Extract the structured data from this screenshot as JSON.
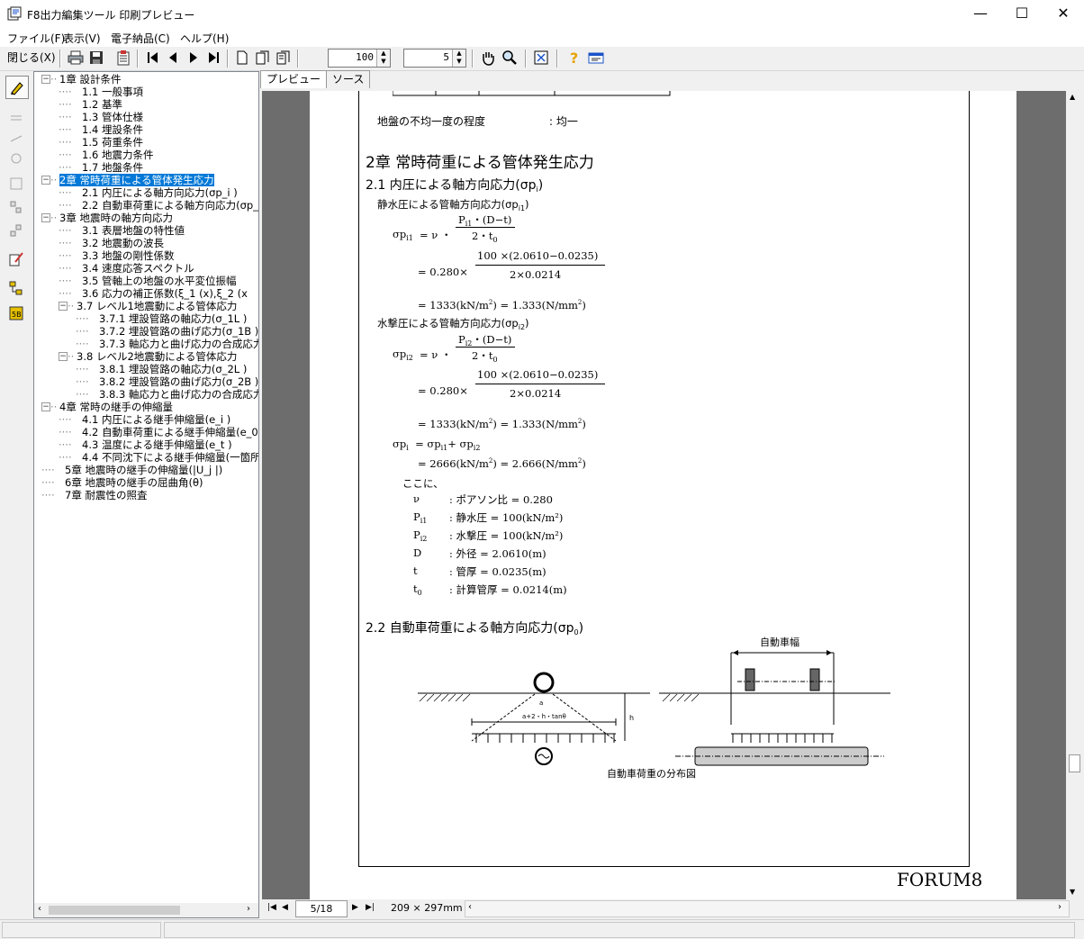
{
  "window": {
    "title": "F8出力編集ツール 印刷プレビュー",
    "minimize": "—",
    "maximize": "☐",
    "close": "✕"
  },
  "menu": [
    "ファイル(F)",
    "表示(V)",
    "電子納品(C)",
    "ヘルプ(H)"
  ],
  "toolbar": {
    "close_label": "閉じる(X)",
    "zoom_value": "100",
    "page_count_value": "5"
  },
  "tabs": [
    "プレビュー",
    "ソース"
  ],
  "tree": [
    {
      "label": "1章 設計条件",
      "level": 0,
      "box": "−"
    },
    {
      "label": "1.1 一般事項",
      "level": 1
    },
    {
      "label": "1.2 基準",
      "level": 1
    },
    {
      "label": "1.3 管体仕様",
      "level": 1
    },
    {
      "label": "1.4 埋設条件",
      "level": 1
    },
    {
      "label": "1.5 荷重条件",
      "level": 1
    },
    {
      "label": "1.6 地震力条件",
      "level": 1
    },
    {
      "label": "1.7 地盤条件",
      "level": 1
    },
    {
      "label": "2章 常時荷重による管体発生応力",
      "level": 0,
      "box": "−",
      "selected": true
    },
    {
      "label": "2.1 内圧による軸方向応力(σp_i )",
      "level": 1
    },
    {
      "label": "2.2 自動車荷重による軸方向応力(σp_",
      "level": 1
    },
    {
      "label": "3章 地震時の軸方向応力",
      "level": 0,
      "box": "−"
    },
    {
      "label": "3.1 表層地盤の特性値",
      "level": 1
    },
    {
      "label": "3.2 地震動の波長",
      "level": 1
    },
    {
      "label": "3.3 地盤の剛性係数",
      "level": 1
    },
    {
      "label": "3.4 速度応答スペクトル",
      "level": 1
    },
    {
      "label": "3.5 管軸上の地盤の水平変位振幅",
      "level": 1
    },
    {
      "label": "3.6 応力の補正係数(ξ_1 (x),ξ_2 (x",
      "level": 1
    },
    {
      "label": "3.7 レベル1地震動による管体応力",
      "level": 1,
      "box": "−"
    },
    {
      "label": "3.7.1 埋設管路の軸応力(σ_1L )",
      "level": 2
    },
    {
      "label": "3.7.2 埋設管路の曲げ応力(σ_1B )",
      "level": 2
    },
    {
      "label": "3.7.3 軸応力と曲げ応力の合成応力",
      "level": 2
    },
    {
      "label": "3.8 レベル2地震動による管体応力",
      "level": 1,
      "box": "−"
    },
    {
      "label": "3.8.1 埋設管路の軸応力(σ_2L )",
      "level": 2
    },
    {
      "label": "3.8.2 埋設管路の曲げ応力(σ_2B )",
      "level": 2
    },
    {
      "label": "3.8.3 軸応力と曲げ応力の合成応力",
      "level": 2
    },
    {
      "label": "4章 常時の継手の伸縮量",
      "level": 0,
      "box": "−"
    },
    {
      "label": "4.1 内圧による継手伸縮量(e_i )",
      "level": 1
    },
    {
      "label": "4.2 自動車荷重による継手伸縮量(e_0",
      "level": 1
    },
    {
      "label": "4.3 温度による継手伸縮量(e_t )",
      "level": 1
    },
    {
      "label": "4.4 不同沈下による継手伸縮量(一箇所",
      "level": 1
    },
    {
      "label": "5章 地震時の継手の伸縮量(|U_j |)",
      "level": 0
    },
    {
      "label": "6章 地震時の継手の屈曲角(θ)",
      "level": 0
    },
    {
      "label": "7章 耐震性の照査",
      "level": 0
    }
  ],
  "doc": {
    "ground_line": "地盤の不均一度の程度",
    "ground_value": ":  均一",
    "chapter": "2章  常時荷重による管体発生応力",
    "sec21": "2.1 内圧による軸方向応力(σp",
    "sec21_sub": "i",
    "static_title": "静水圧による管軸方向応力(σp",
    "static_sub": "i1",
    "water_title": "水撃圧による管軸方向応力(σp",
    "water_sub": "i2",
    "eq_lhs1": "σp",
    "eq_lhs1_sub": "i1",
    "eq_lhs2": "σp",
    "eq_lhs2_sub": "i2",
    "eq_nu": "=  ν ・",
    "num1": "P",
    "num1_sub": "i1",
    "num_tail": "・(D−t)",
    "num2": "P",
    "num2_sub": "i2",
    "den": "2・t",
    "den_sub": "0",
    "step_coef": "= 0.280×",
    "step_num": "100  ×(2.0610−0.0235)",
    "step_den": "2×0.0214",
    "result1": "= 1333(kN/m",
    "result1b": ") = 1.333(N/mm",
    "sum_lhs": "σp",
    "sum_lhs_sub": "i",
    "sum_rhs": "= σp",
    "sum_rhs_sub1": "i1",
    "sum_plus": "+ σp",
    "sum_rhs_sub2": "i2",
    "result_sum": "= 2666(kN/m",
    "result_sum_b": ") = 2.666(N/mm",
    "here": "ここに、",
    "defs": [
      {
        "sym": "ν",
        "sub": "",
        "text": ":  ポアソン比 = 0.280"
      },
      {
        "sym": "P",
        "sub": "i1",
        "text": ":  静水圧 = 100(kN/m²)"
      },
      {
        "sym": "P",
        "sub": "i2",
        "text": ":  水撃圧 = 100(kN/m²)"
      },
      {
        "sym": "D",
        "sub": "",
        "text": ":  外径 = 2.0610(m)"
      },
      {
        "sym": "t",
        "sub": "",
        "text": ":  管厚 = 0.0235(m)"
      },
      {
        "sym": "t",
        "sub": "0",
        "text": ":  計算管厚 = 0.0214(m)"
      }
    ],
    "sec22": "2.2 自動車荷重による軸方向応力(σp",
    "sec22_sub": "0",
    "fig_width_label": "自動車幅",
    "fig_a_label": "a",
    "fig_spread_label": "a+2・h・tanθ",
    "fig_h_label": "h",
    "fig_caption": "自動車荷重の分布図",
    "logo": "FORUM8"
  },
  "nav": {
    "page": "5/18",
    "paper": "209 × 297mm"
  }
}
